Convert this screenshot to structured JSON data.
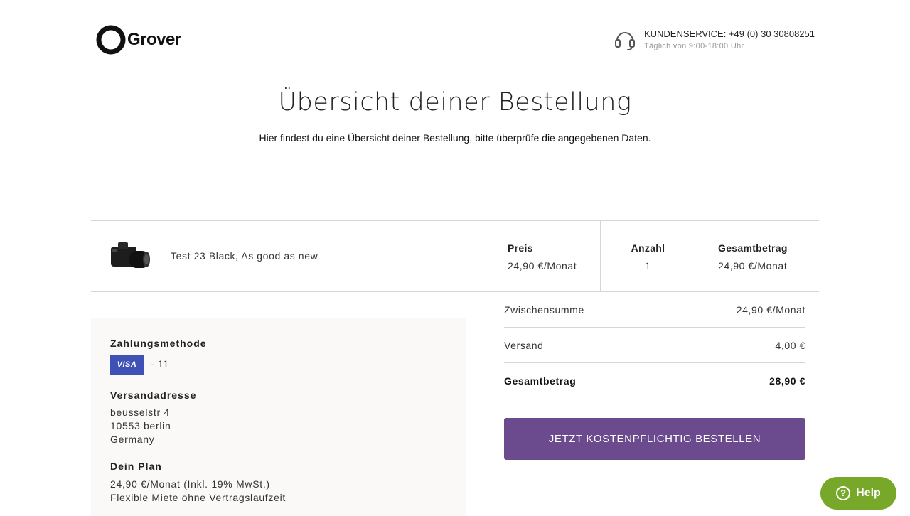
{
  "brand": {
    "name": "Grover"
  },
  "service": {
    "line1": "KUNDENSERVICE: +49 (0) 30 30808251",
    "line2": "Täglich von 9:00-18:00 Uhr",
    "icon": "headset-icon"
  },
  "page": {
    "title": "Übersicht deiner Bestellung",
    "subtitle": "Hier findest du eine Übersicht deiner Bestellung, bitte überprüfe die angegebenen Daten."
  },
  "product": {
    "name": "Test 23 Black, As good as new",
    "image_icon": "camera-icon",
    "columns": [
      {
        "label": "Preis",
        "value": "24,90 €/Monat"
      },
      {
        "label": "Anzahl",
        "value": "1"
      },
      {
        "label": "Gesamtbetrag",
        "value": "24,90 €/Monat"
      }
    ]
  },
  "details": {
    "payment_label": "Zahlungsmethode",
    "card_brand": "VISA",
    "card_tail": "- 11",
    "address_label": "Versandadresse",
    "address_lines": [
      "beusselstr 4",
      "10553 berlin",
      "Germany"
    ],
    "plan_label": "Dein Plan",
    "plan_lines": [
      "24,90 €/Monat (Inkl. 19% MwSt.)",
      "Flexible Miete ohne Vertragslaufzeit"
    ]
  },
  "summary": {
    "rows": [
      {
        "label": "Zwischensumme",
        "value": "24,90 €/Monat"
      },
      {
        "label": "Versand",
        "value": "4,00 €"
      },
      {
        "label": "Gesamtbetrag",
        "value": "28,90 €"
      }
    ],
    "order_button": "JETZT KOSTENPFLICHTIG BESTELLEN"
  },
  "help": {
    "label": "Help",
    "icon": "question-icon"
  },
  "colors": {
    "primary_button": "#6b4a8e",
    "help_button": "#78a82a",
    "visa": "#3f51b5"
  }
}
